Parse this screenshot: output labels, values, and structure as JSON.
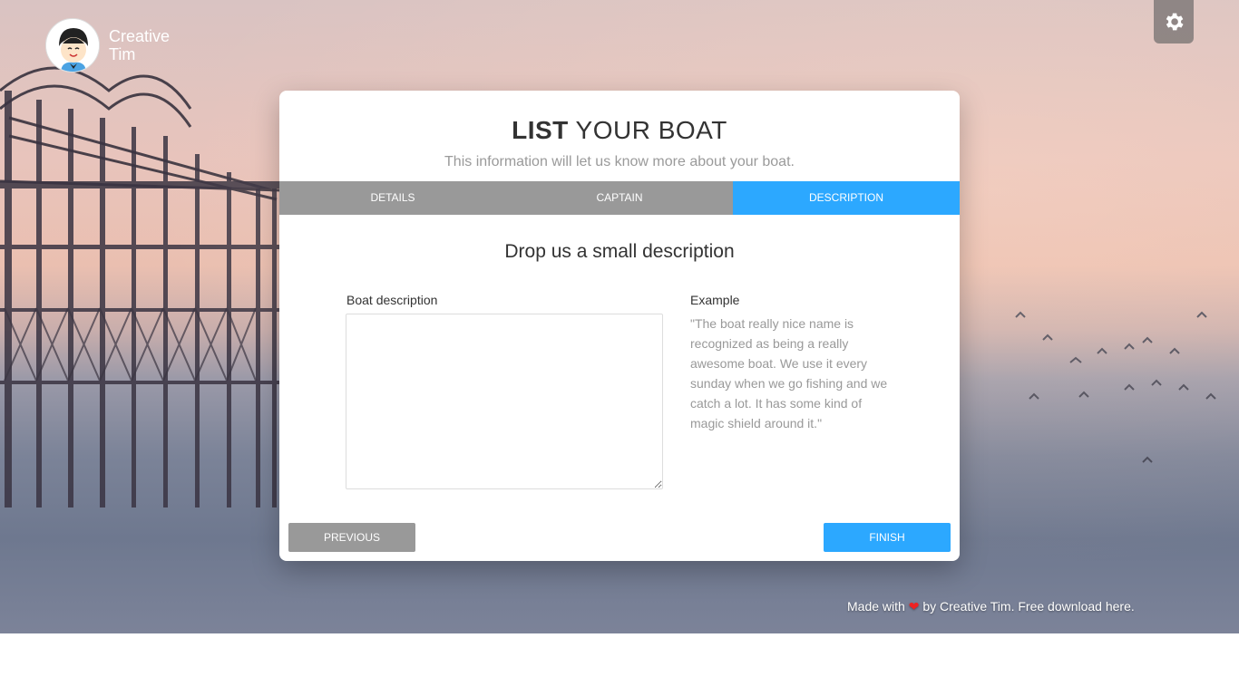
{
  "brand": {
    "name": "Creative Tim"
  },
  "settings": {
    "icon": "gear-icon"
  },
  "wizard": {
    "title_bold": "LIST",
    "title_rest": "YOUR BOAT",
    "subtitle": "This information will let us know more about your boat.",
    "tabs": [
      {
        "label": "DETAILS",
        "active": false
      },
      {
        "label": "CAPTAIN",
        "active": false
      },
      {
        "label": "DESCRIPTION",
        "active": true
      }
    ],
    "step_title": "Drop us a small description",
    "boat_description_label": "Boat description",
    "boat_description_value": "",
    "example_label": "Example",
    "example_text": "\"The boat really nice name is recognized as being a really awesome boat. We use it every sunday when we go fishing and we catch a lot. It has some kind of magic shield around it.\"",
    "previous_label": "PREVIOUS",
    "finish_label": "FINISH"
  },
  "footer": {
    "prefix": "Made with",
    "heart": "❤",
    "by": "by Creative Tim.",
    "link": "Free download here."
  },
  "colors": {
    "accent": "#2ca8ff",
    "tab_inactive": "#999999"
  }
}
